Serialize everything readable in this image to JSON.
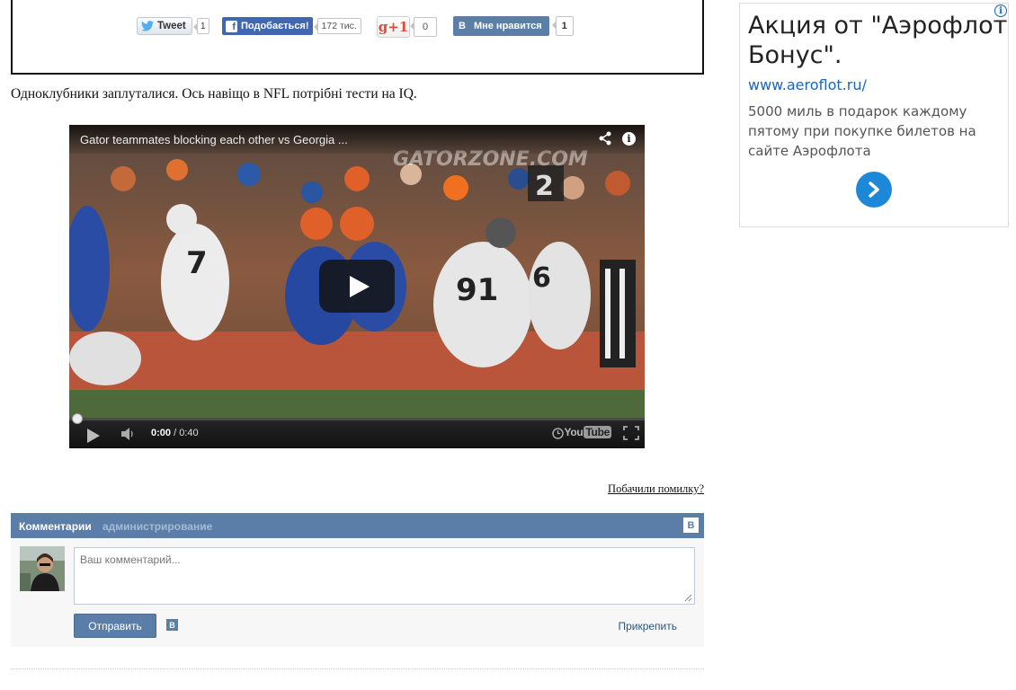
{
  "share": {
    "tweet_label": "Tweet",
    "tweet_count": "1",
    "fb_label": "Подобається!",
    "fb_count": "172 тис.",
    "gplus_label": "g+1",
    "gplus_count": "0",
    "vk_letter": "B",
    "vk_label": "Мне нравится",
    "vk_count": "1"
  },
  "article": {
    "text": "Одноклубники заплуталися. Ось навіщо в NFL потрібні тести на IQ."
  },
  "video": {
    "title": "Gator teammates blocking each other vs Georgia ...",
    "current_time": "0:00",
    "duration": "/ 0:40",
    "logo_you": "You",
    "logo_tube": "Tube",
    "scoreboard": "2",
    "watermark": "GATORZONE.COM",
    "jersey_left": "7",
    "jersey_mid": "91",
    "jersey_right": "6",
    "icons": [
      "share-icon",
      "info-icon",
      "play-icon",
      "volume-icon",
      "clock-icon",
      "fullscreen-icon"
    ]
  },
  "report_link": "Побачили помилку?",
  "comments": {
    "title": "Комментарии",
    "admin_link": "администрирование",
    "vk_badge": "B",
    "placeholder": "Ваш комментарий...",
    "send_label": "Отправить",
    "vk_small": "B",
    "attach_label": "Прикрепить"
  },
  "ad": {
    "info": "i",
    "headline": "Акция от \"Аэрофлот Бонус\".",
    "url": "www.aeroflot.ru/",
    "description": "5000 миль в подарок каждому пятому при покупке билетов на сайте Аэрофлота"
  },
  "colors": {
    "vk_blue": "#5b7ea8",
    "facebook_blue": "#4267b2",
    "gplus_red": "#dd4b39",
    "ad_link": "#1a66b8",
    "ad_arrow": "#1e88d8"
  }
}
